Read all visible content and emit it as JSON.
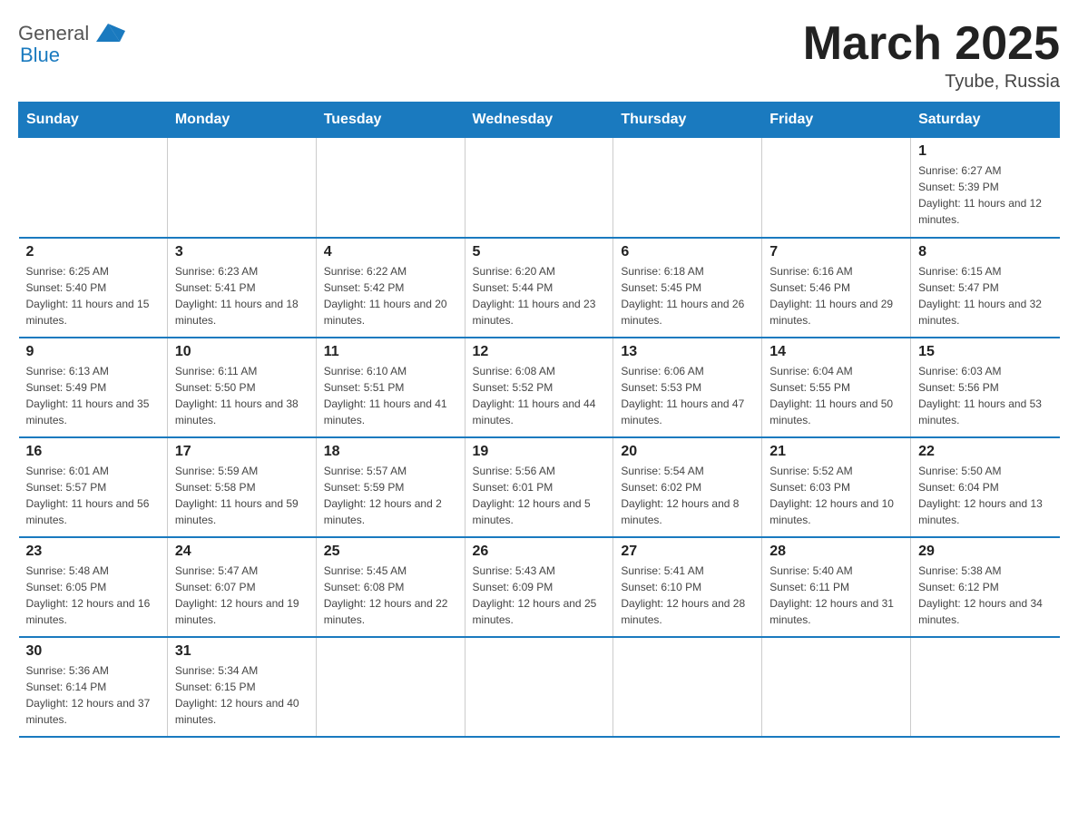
{
  "header": {
    "logo_general": "General",
    "logo_blue": "Blue",
    "month_title": "March 2025",
    "location": "Tyube, Russia"
  },
  "weekdays": [
    "Sunday",
    "Monday",
    "Tuesday",
    "Wednesday",
    "Thursday",
    "Friday",
    "Saturday"
  ],
  "weeks": [
    [
      {
        "day": "",
        "info": ""
      },
      {
        "day": "",
        "info": ""
      },
      {
        "day": "",
        "info": ""
      },
      {
        "day": "",
        "info": ""
      },
      {
        "day": "",
        "info": ""
      },
      {
        "day": "",
        "info": ""
      },
      {
        "day": "1",
        "info": "Sunrise: 6:27 AM\nSunset: 5:39 PM\nDaylight: 11 hours and 12 minutes."
      }
    ],
    [
      {
        "day": "2",
        "info": "Sunrise: 6:25 AM\nSunset: 5:40 PM\nDaylight: 11 hours and 15 minutes."
      },
      {
        "day": "3",
        "info": "Sunrise: 6:23 AM\nSunset: 5:41 PM\nDaylight: 11 hours and 18 minutes."
      },
      {
        "day": "4",
        "info": "Sunrise: 6:22 AM\nSunset: 5:42 PM\nDaylight: 11 hours and 20 minutes."
      },
      {
        "day": "5",
        "info": "Sunrise: 6:20 AM\nSunset: 5:44 PM\nDaylight: 11 hours and 23 minutes."
      },
      {
        "day": "6",
        "info": "Sunrise: 6:18 AM\nSunset: 5:45 PM\nDaylight: 11 hours and 26 minutes."
      },
      {
        "day": "7",
        "info": "Sunrise: 6:16 AM\nSunset: 5:46 PM\nDaylight: 11 hours and 29 minutes."
      },
      {
        "day": "8",
        "info": "Sunrise: 6:15 AM\nSunset: 5:47 PM\nDaylight: 11 hours and 32 minutes."
      }
    ],
    [
      {
        "day": "9",
        "info": "Sunrise: 6:13 AM\nSunset: 5:49 PM\nDaylight: 11 hours and 35 minutes."
      },
      {
        "day": "10",
        "info": "Sunrise: 6:11 AM\nSunset: 5:50 PM\nDaylight: 11 hours and 38 minutes."
      },
      {
        "day": "11",
        "info": "Sunrise: 6:10 AM\nSunset: 5:51 PM\nDaylight: 11 hours and 41 minutes."
      },
      {
        "day": "12",
        "info": "Sunrise: 6:08 AM\nSunset: 5:52 PM\nDaylight: 11 hours and 44 minutes."
      },
      {
        "day": "13",
        "info": "Sunrise: 6:06 AM\nSunset: 5:53 PM\nDaylight: 11 hours and 47 minutes."
      },
      {
        "day": "14",
        "info": "Sunrise: 6:04 AM\nSunset: 5:55 PM\nDaylight: 11 hours and 50 minutes."
      },
      {
        "day": "15",
        "info": "Sunrise: 6:03 AM\nSunset: 5:56 PM\nDaylight: 11 hours and 53 minutes."
      }
    ],
    [
      {
        "day": "16",
        "info": "Sunrise: 6:01 AM\nSunset: 5:57 PM\nDaylight: 11 hours and 56 minutes."
      },
      {
        "day": "17",
        "info": "Sunrise: 5:59 AM\nSunset: 5:58 PM\nDaylight: 11 hours and 59 minutes."
      },
      {
        "day": "18",
        "info": "Sunrise: 5:57 AM\nSunset: 5:59 PM\nDaylight: 12 hours and 2 minutes."
      },
      {
        "day": "19",
        "info": "Sunrise: 5:56 AM\nSunset: 6:01 PM\nDaylight: 12 hours and 5 minutes."
      },
      {
        "day": "20",
        "info": "Sunrise: 5:54 AM\nSunset: 6:02 PM\nDaylight: 12 hours and 8 minutes."
      },
      {
        "day": "21",
        "info": "Sunrise: 5:52 AM\nSunset: 6:03 PM\nDaylight: 12 hours and 10 minutes."
      },
      {
        "day": "22",
        "info": "Sunrise: 5:50 AM\nSunset: 6:04 PM\nDaylight: 12 hours and 13 minutes."
      }
    ],
    [
      {
        "day": "23",
        "info": "Sunrise: 5:48 AM\nSunset: 6:05 PM\nDaylight: 12 hours and 16 minutes."
      },
      {
        "day": "24",
        "info": "Sunrise: 5:47 AM\nSunset: 6:07 PM\nDaylight: 12 hours and 19 minutes."
      },
      {
        "day": "25",
        "info": "Sunrise: 5:45 AM\nSunset: 6:08 PM\nDaylight: 12 hours and 22 minutes."
      },
      {
        "day": "26",
        "info": "Sunrise: 5:43 AM\nSunset: 6:09 PM\nDaylight: 12 hours and 25 minutes."
      },
      {
        "day": "27",
        "info": "Sunrise: 5:41 AM\nSunset: 6:10 PM\nDaylight: 12 hours and 28 minutes."
      },
      {
        "day": "28",
        "info": "Sunrise: 5:40 AM\nSunset: 6:11 PM\nDaylight: 12 hours and 31 minutes."
      },
      {
        "day": "29",
        "info": "Sunrise: 5:38 AM\nSunset: 6:12 PM\nDaylight: 12 hours and 34 minutes."
      }
    ],
    [
      {
        "day": "30",
        "info": "Sunrise: 5:36 AM\nSunset: 6:14 PM\nDaylight: 12 hours and 37 minutes."
      },
      {
        "day": "31",
        "info": "Sunrise: 5:34 AM\nSunset: 6:15 PM\nDaylight: 12 hours and 40 minutes."
      },
      {
        "day": "",
        "info": ""
      },
      {
        "day": "",
        "info": ""
      },
      {
        "day": "",
        "info": ""
      },
      {
        "day": "",
        "info": ""
      },
      {
        "day": "",
        "info": ""
      }
    ]
  ]
}
